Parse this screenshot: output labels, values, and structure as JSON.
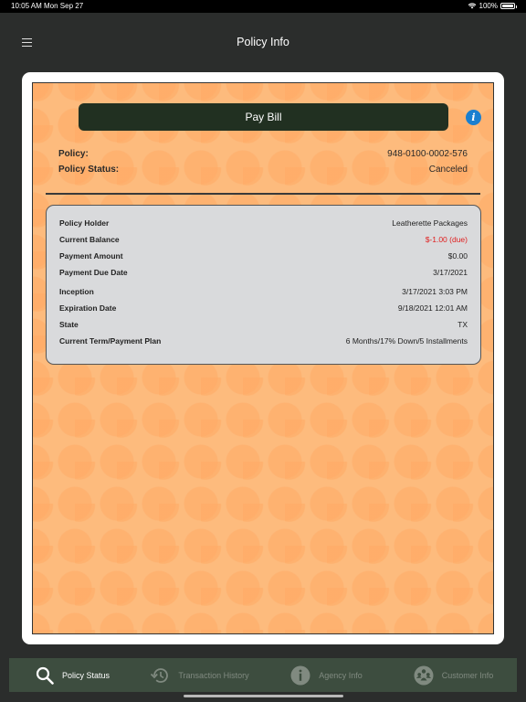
{
  "status_bar": {
    "time": "10:05 AM",
    "date": "Mon Sep 27",
    "battery": "100%"
  },
  "nav": {
    "title": "Policy Info"
  },
  "pay_bill_label": "Pay Bill",
  "policy": {
    "policy_label": "Policy:",
    "policy_value": "948-0100-0002-576",
    "status_label": "Policy Status:",
    "status_value": "Canceled"
  },
  "details": [
    {
      "label": "Policy Holder",
      "value": "Leatherette Packages"
    },
    {
      "label": "Current Balance",
      "value": "$-1.00 (due)",
      "highlight": true
    },
    {
      "label": "Payment Amount",
      "value": "$0.00"
    },
    {
      "label": "Payment Due Date",
      "value": "3/17/2021"
    },
    {
      "label": "Inception",
      "value": "3/17/2021 3:03 PM"
    },
    {
      "label": "Expiration Date",
      "value": "9/18/2021 12:01 AM"
    },
    {
      "label": "State",
      "value": "TX"
    },
    {
      "label": "Current Term/Payment Plan",
      "value": "6 Months/17% Down/5 Installments"
    }
  ],
  "colors": {
    "panel": "#fdbb7d",
    "button": "#213021",
    "due": "#e02020",
    "tab_bar": "#3d4d3f",
    "info": "#1a7fd0"
  },
  "tabs": [
    {
      "label": "Policy Status",
      "icon": "search-icon",
      "active": true
    },
    {
      "label": "Transaction History",
      "icon": "history-icon",
      "active": false
    },
    {
      "label": "Agency Info",
      "icon": "info-icon",
      "active": false
    },
    {
      "label": "Customer Info",
      "icon": "customers-icon",
      "active": false
    }
  ]
}
